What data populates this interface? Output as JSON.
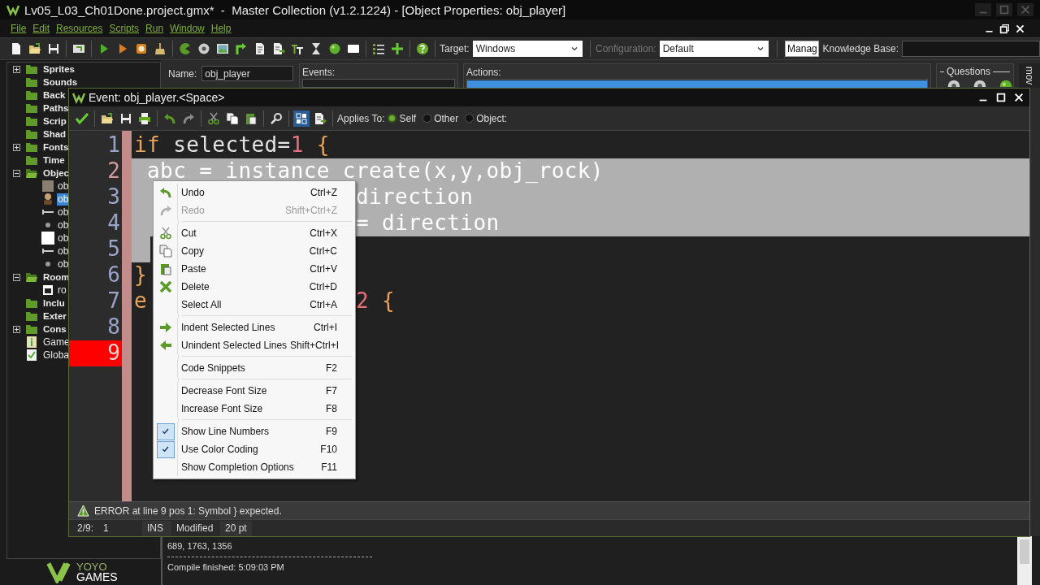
{
  "window": {
    "title": "Lv05_L03_Ch01Done.project.gmx*  -  Master Collection (v1.2.1224) - [Object Properties: obj_player]"
  },
  "menu": [
    "File",
    "Edit",
    "Resources",
    "Scripts",
    "Run",
    "Window",
    "Help"
  ],
  "toolbar": {
    "target_label": "Target:",
    "target": "Windows",
    "config_label": "Configuration:",
    "config": "Default",
    "manage_button": "Manag",
    "kb_label": "Knowledge Base:"
  },
  "tree": [
    {
      "label": "Sprites",
      "kind": "folder",
      "expanded": false,
      "selected": false
    },
    {
      "label": "Sounds",
      "kind": "folder",
      "selected": false
    },
    {
      "label": "Back",
      "kind": "folder",
      "selected": false
    },
    {
      "label": "Paths",
      "kind": "folder",
      "selected": false
    },
    {
      "label": "Scrip",
      "kind": "folder",
      "selected": false
    },
    {
      "label": "Shad",
      "kind": "folder",
      "selected": false
    },
    {
      "label": "Fonts",
      "kind": "folder",
      "expanded": false,
      "selected": false
    },
    {
      "label": "Time",
      "kind": "folder",
      "selected": false
    },
    {
      "label": "Objec",
      "kind": "folder",
      "expanded": true,
      "selected": false,
      "children": [
        {
          "label": "ob",
          "kind": "object",
          "selected": false
        },
        {
          "label": "ob",
          "kind": "object",
          "selected": true
        },
        {
          "label": "ob",
          "kind": "object",
          "selected": false
        },
        {
          "label": "ob",
          "kind": "object",
          "selected": false
        },
        {
          "label": "ob",
          "kind": "object",
          "selected": false
        },
        {
          "label": "ob",
          "kind": "object",
          "selected": false
        },
        {
          "label": "ob",
          "kind": "object",
          "selected": false
        }
      ]
    },
    {
      "label": "Room",
      "kind": "folder",
      "expanded": true,
      "selected": false,
      "children": [
        {
          "label": "ro",
          "kind": "room",
          "selected": false
        }
      ]
    },
    {
      "label": "Inclu",
      "kind": "folder",
      "selected": false
    },
    {
      "label": "Exter",
      "kind": "folder",
      "selected": false
    },
    {
      "label": "Cons",
      "kind": "folder",
      "expanded": false,
      "selected": false
    },
    {
      "label": "Game",
      "kind": "info",
      "selected": false
    },
    {
      "label": "Globa",
      "kind": "settings",
      "selected": false
    }
  ],
  "object_properties": {
    "name_label": "Name:",
    "name": "obj_player",
    "events_label": "Events:",
    "actions_label": "Actions:",
    "questions_label": "Questions",
    "side_tab": "mov"
  },
  "output": [
    {
      "kind": "text",
      "text": "689, 1763, 1356"
    },
    {
      "kind": "rule"
    },
    {
      "kind": "text",
      "text": "Compile finished: 5:09:03 PM"
    }
  ],
  "logo": {
    "top": "YOYO",
    "bottom": "GAMES"
  },
  "event_window": {
    "title": "Event: obj_player.<Space>",
    "applies_label": "Applies To:",
    "applies": [
      {
        "label": "Self",
        "selected": true
      },
      {
        "label": "Other",
        "selected": false
      },
      {
        "label": "Object:",
        "selected": false
      }
    ],
    "lines": [
      {
        "number": "1",
        "tokens": [
          {
            "text": "if",
            "kind": "keyword"
          },
          {
            "text": " selected=",
            "kind": "plain"
          },
          {
            "text": "1",
            "kind": "number"
          },
          {
            "text": " {",
            "kind": "keyword"
          }
        ],
        "selected": false,
        "current": false,
        "error": false
      },
      {
        "number": "2",
        "tokens": [
          {
            "text": " abc = instance_create(x,y,obj_rock)",
            "kind": "plain"
          }
        ],
        "selected": true,
        "current": true,
        "error": false
      },
      {
        "number": "3",
        "tokens": [
          {
            "text": "                 direction",
            "kind": "plain"
          }
        ],
        "selected": true,
        "current": false,
        "error": false
      },
      {
        "number": "4",
        "tokens": [
          {
            "text": "                 = direction",
            "kind": "plain"
          }
        ],
        "selected": true,
        "current": false,
        "error": false
      },
      {
        "number": "5",
        "selected": true,
        "current": false,
        "error": false
      },
      {
        "number": "6",
        "tokens": [
          {
            "text": "}",
            "kind": "keyword"
          }
        ],
        "selected": false,
        "current": false,
        "error": false
      },
      {
        "number": "7",
        "tokens": [
          {
            "text": "e",
            "kind": "keyword"
          },
          {
            "text": "                2",
            "kind": "number"
          },
          {
            "text": " {",
            "kind": "keyword"
          }
        ],
        "selected": false,
        "current": false,
        "error": false
      },
      {
        "number": "8",
        "selected": false,
        "current": false,
        "error": false
      },
      {
        "number": "9",
        "selected": false,
        "current": false,
        "error": true
      }
    ],
    "error": "ERROR at line 9 pos 1: Symbol } expected.",
    "status": [
      "2/9:",
      "1",
      "INS",
      "Modified",
      "20 pt"
    ]
  },
  "context_menu": [
    {
      "kind": "item",
      "label": "Undo",
      "shortcut": "Ctrl+Z",
      "disabled": false,
      "checked": false
    },
    {
      "kind": "item",
      "label": "Redo",
      "shortcut": "Shift+Ctrl+Z",
      "disabled": true,
      "checked": false
    },
    {
      "kind": "separator"
    },
    {
      "kind": "item",
      "label": "Cut",
      "shortcut": "Ctrl+X",
      "disabled": false,
      "checked": false
    },
    {
      "kind": "item",
      "label": "Copy",
      "shortcut": "Ctrl+C",
      "disabled": false,
      "checked": false
    },
    {
      "kind": "item",
      "label": "Paste",
      "shortcut": "Ctrl+V",
      "disabled": false,
      "checked": false
    },
    {
      "kind": "item",
      "label": "Delete",
      "shortcut": "Ctrl+D",
      "disabled": false,
      "checked": false
    },
    {
      "kind": "item",
      "label": "Select All",
      "shortcut": "Ctrl+A",
      "disabled": false,
      "checked": false
    },
    {
      "kind": "separator"
    },
    {
      "kind": "item",
      "label": "Indent Selected Lines",
      "shortcut": "Ctrl+I",
      "disabled": false,
      "checked": false
    },
    {
      "kind": "item",
      "label": "Unindent Selected Lines",
      "shortcut": "Shift+Ctrl+I",
      "disabled": false,
      "checked": false
    },
    {
      "kind": "separator"
    },
    {
      "kind": "item",
      "label": "Code Snippets",
      "shortcut": "F2",
      "disabled": false,
      "checked": false
    },
    {
      "kind": "separator"
    },
    {
      "kind": "item",
      "label": "Decrease Font Size",
      "shortcut": "F7",
      "disabled": false,
      "checked": false
    },
    {
      "kind": "item",
      "label": "Increase Font Size",
      "shortcut": "F8",
      "disabled": false,
      "checked": false
    },
    {
      "kind": "separator"
    },
    {
      "kind": "item",
      "label": "Show Line Numbers",
      "shortcut": "F9",
      "disabled": false,
      "checked": true
    },
    {
      "kind": "item",
      "label": "Use Color Coding",
      "shortcut": "F10",
      "disabled": false,
      "checked": true
    },
    {
      "kind": "item",
      "label": "Show Completion Options",
      "shortcut": "F11",
      "disabled": false,
      "checked": false
    }
  ]
}
